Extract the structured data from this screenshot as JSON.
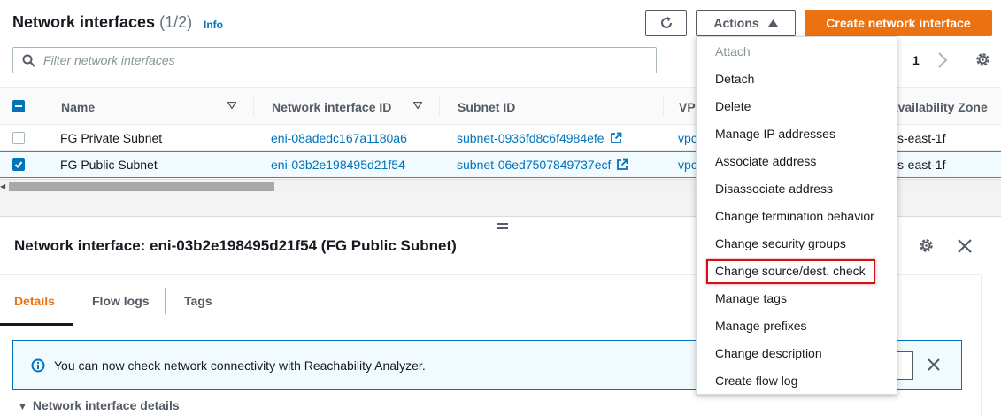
{
  "header": {
    "title": "Network interfaces",
    "count": "(1/2)",
    "info_label": "Info",
    "actions_label": "Actions",
    "create_label": "Create network interface"
  },
  "filter": {
    "placeholder": "Filter network interfaces"
  },
  "pagination": {
    "current_page": "1"
  },
  "table": {
    "columns": [
      "Name",
      "Network interface ID",
      "Subnet ID",
      "VPC",
      "Availability Zone"
    ],
    "rows": [
      {
        "name": "FG Private Subnet",
        "eni_id": "eni-08adedc167a1180a6",
        "subnet_id": "subnet-0936fd8c6f4984efe",
        "vpc": "vpc",
        "az": "s-east-1f",
        "selected": false
      },
      {
        "name": "FG Public Subnet",
        "eni_id": "eni-03b2e198495d21f54",
        "subnet_id": "subnet-06ed7507849737ecf",
        "vpc": "vpc",
        "az": "s-east-1f",
        "selected": true
      }
    ]
  },
  "actions_menu": {
    "items": [
      {
        "label": "Attach",
        "disabled": true
      },
      {
        "label": "Detach",
        "disabled": false
      },
      {
        "label": "Delete",
        "disabled": false
      },
      {
        "label": "Manage IP addresses",
        "disabled": false
      },
      {
        "label": "Associate address",
        "disabled": false
      },
      {
        "label": "Disassociate address",
        "disabled": false
      },
      {
        "label": "Change termination behavior",
        "disabled": false
      },
      {
        "label": "Change security groups",
        "disabled": false
      },
      {
        "label": "Change source/dest. check",
        "disabled": false,
        "highlighted": true
      },
      {
        "label": "Manage tags",
        "disabled": false
      },
      {
        "label": "Manage prefixes",
        "disabled": false
      },
      {
        "label": "Change description",
        "disabled": false
      },
      {
        "label": "Create flow log",
        "disabled": false
      }
    ]
  },
  "detail": {
    "title": "Network interface: eni-03b2e198495d21f54 (FG Public Subnet)",
    "tabs": [
      "Details",
      "Flow logs",
      "Tags"
    ],
    "active_tab": "Details",
    "alert_message": "You can now check network connectivity with Reachability Analyzer.",
    "section_heading": "Network interface details"
  },
  "colors": {
    "primary_orange": "#ec7211",
    "link_blue": "#0073bb",
    "highlight_red": "#d0111a"
  }
}
